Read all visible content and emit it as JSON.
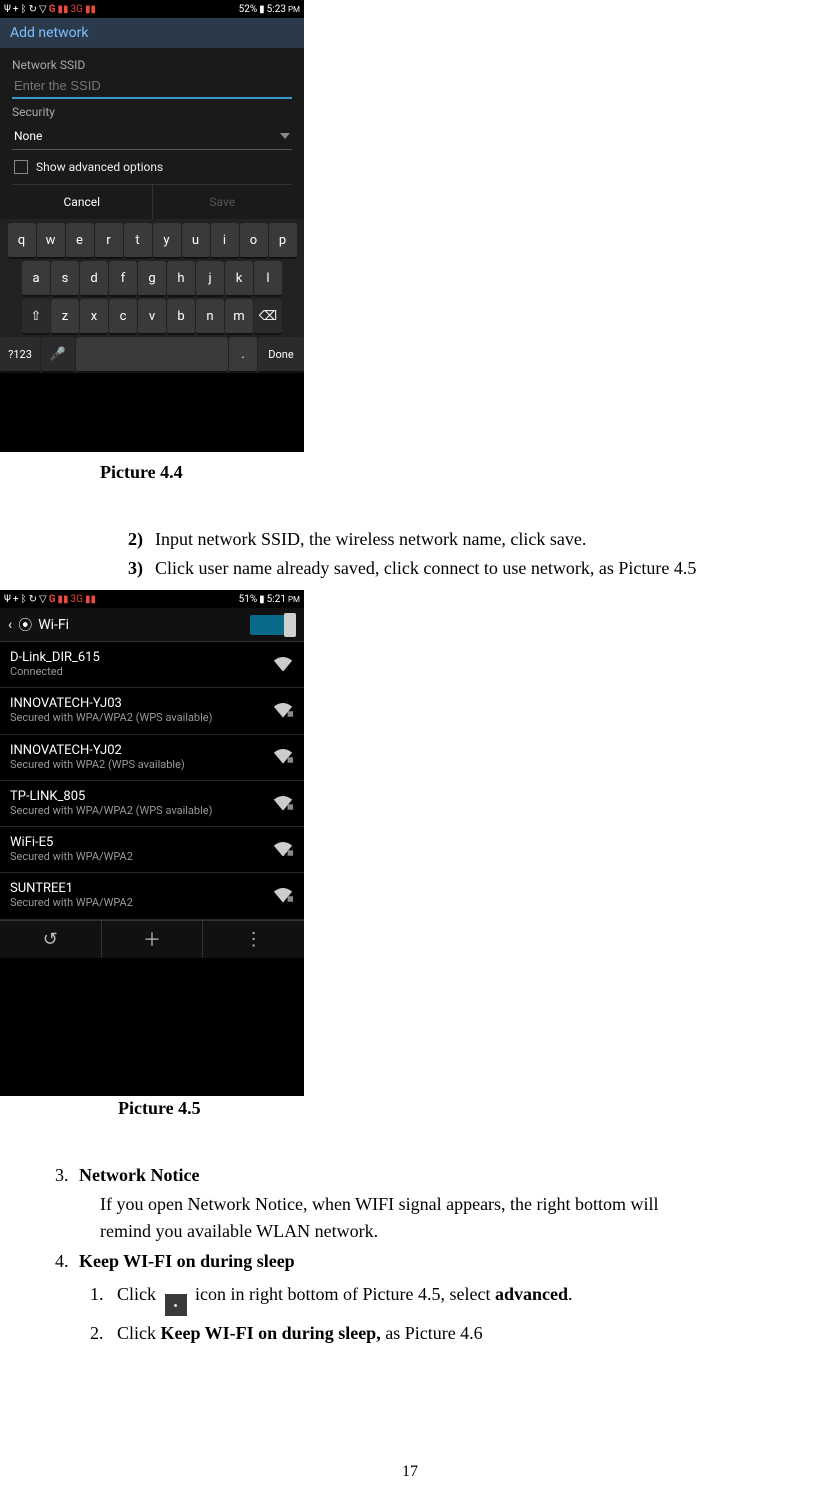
{
  "page_number": "17",
  "captions": {
    "p44": "Picture 4.4",
    "p45": "Picture 4.5"
  },
  "shot44": {
    "status": {
      "battery_pct": "52%",
      "time": "5:23",
      "pm": "PM",
      "net": "3G"
    },
    "title": "Add network",
    "ssid_label": "Network SSID",
    "ssid_placeholder": "Enter the SSID",
    "security_label": "Security",
    "security_value": "None",
    "show_adv": "Show advanced options",
    "cancel": "Cancel",
    "save": "Save",
    "keyboard": {
      "row1": [
        "q",
        "w",
        "e",
        "r",
        "t",
        "y",
        "u",
        "i",
        "o",
        "p"
      ],
      "row2": [
        "a",
        "s",
        "d",
        "f",
        "g",
        "h",
        "j",
        "k",
        "l"
      ],
      "row3": [
        "⇧",
        "z",
        "x",
        "c",
        "v",
        "b",
        "n",
        "m",
        "⌫"
      ],
      "sym": "?123",
      "done": "Done",
      "dot": "."
    }
  },
  "steps_4_4": {
    "s2_num": "2)",
    "s2": "Input network SSID, the wireless network name, click save.",
    "s3_num": "3)",
    "s3": "Click user name already saved, click connect to use network, as Picture 4.5"
  },
  "shot45": {
    "status": {
      "battery_pct": "51%",
      "time": "5:21",
      "pm": "PM",
      "net": "3G"
    },
    "head": "Wi-Fi",
    "toggle_state": "I",
    "networks": [
      {
        "name": "D-Link_DIR_615",
        "sub": "Connected"
      },
      {
        "name": "INNOVATECH-YJ03",
        "sub": "Secured with WPA/WPA2 (WPS available)"
      },
      {
        "name": "INNOVATECH-YJ02",
        "sub": "Secured with WPA2 (WPS available)"
      },
      {
        "name": "TP-LINK_805",
        "sub": "Secured with WPA/WPA2 (WPS available)"
      },
      {
        "name": "WiFi-E5",
        "sub": "Secured with WPA/WPA2"
      },
      {
        "name": "SUNTREE1",
        "sub": "Secured with WPA/WPA2"
      }
    ]
  },
  "section3": {
    "num": "3.",
    "title": "Network Notice",
    "body_l1": "If you open Network Notice, when WIFI signal appears, the right bottom will",
    "body_l2": "remind you available WLAN network."
  },
  "section4": {
    "num": "4.",
    "title": "Keep WI-FI on during sleep",
    "item1_num": "1.",
    "item1_pre": "Click ",
    "item1_mid": " icon in right bottom of Picture 4.5, select ",
    "item1_bold": "advanced",
    "item1_end": ".",
    "item2_num": "2.",
    "item2_pre": "Click ",
    "item2_bold": "Keep WI-FI on during sleep,",
    "item2_end": " as Picture 4.6"
  }
}
